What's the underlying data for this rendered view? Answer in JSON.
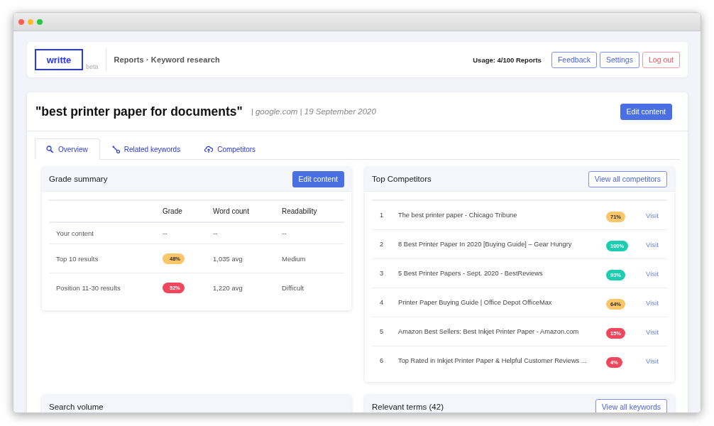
{
  "window": {
    "controls": [
      {
        "kind": "close"
      },
      {
        "kind": "minimize"
      },
      {
        "kind": "zoom"
      }
    ]
  },
  "header": {
    "logo": "writte",
    "badge": "beta",
    "breadcrumb": "Reports · Keyword research",
    "usage": "Usage: 4/100 Reports",
    "buttons": [
      {
        "label": "Feedback",
        "kind": "outline"
      },
      {
        "label": "Settings",
        "kind": "outline"
      },
      {
        "label": "Log out",
        "kind": "danger"
      }
    ]
  },
  "report": {
    "keyword": "\"best printer paper for documents\"",
    "meta": "| google.com | 19 September 2020",
    "action": "Edit content"
  },
  "tabs": [
    {
      "label": "Overview",
      "selected": true
    },
    {
      "label": "Related keywords",
      "selected": false
    },
    {
      "label": "Competitors",
      "selected": false
    }
  ],
  "grade_summary": {
    "title": "Grade summary",
    "action": "Edit content",
    "columns": [
      "Grade",
      "Word count",
      "Readability"
    ],
    "rows": [
      {
        "label": "Your content",
        "grade": {
          "kind": "plain",
          "text": "--"
        },
        "word_count": "--",
        "readability": "--"
      },
      {
        "label": "Top 10 results",
        "grade": {
          "kind": "badge",
          "text": "48%",
          "color": "#fbc66a"
        },
        "word_count": "1,035 avg",
        "readability": "Medium"
      },
      {
        "label": "Position 11-30 results",
        "grade": {
          "kind": "badge",
          "text": "52%",
          "color": "#f0475c"
        },
        "word_count": "1,220 avg",
        "readability": "Difficult"
      }
    ]
  },
  "top_competitors": {
    "title": "Top Competitors",
    "action": "View all competitors",
    "rows": [
      {
        "rank": "1",
        "title": "The best printer paper - Chicago Tribune",
        "score": "71%",
        "color": "#fbc66a",
        "link": "Visit"
      },
      {
        "rank": "2",
        "title": "8 Best Printer Paper In 2020 [Buying Guide] – Gear Hungry",
        "score": "100%",
        "color": "#1ccdb0",
        "link": "Visit"
      },
      {
        "rank": "3",
        "title": "5 Best Printer Papers - Sept. 2020 - BestReviews",
        "score": "93%",
        "color": "#1ccdb0",
        "link": "Visit"
      },
      {
        "rank": "4",
        "title": "Printer Paper Buying Guide | Office Depot OfficeMax",
        "score": "64%",
        "color": "#fbc66a",
        "link": "Visit"
      },
      {
        "rank": "5",
        "title": "Amazon Best Sellers: Best Inkjet Printer Paper - Amazon.com",
        "score": "15%",
        "color": "#f0475c",
        "link": "Visit"
      },
      {
        "rank": "6",
        "title": "Top Rated in Inkjet Printer Paper & Helpful Customer Reviews ...",
        "score": "4%",
        "color": "#f0475c",
        "link": "Visit"
      }
    ]
  },
  "bottom_panels": [
    {
      "title": "Search volume"
    },
    {
      "title": "Relevant terms (42)",
      "action": "View all keywords"
    }
  ]
}
